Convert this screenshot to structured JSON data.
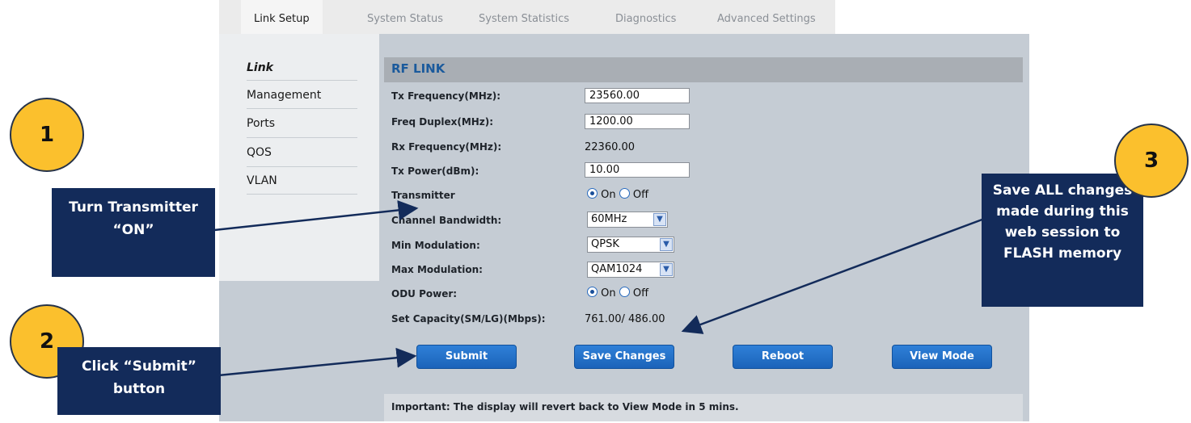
{
  "tabs": [
    {
      "label": "Link Setup",
      "active": true
    },
    {
      "label": "System Status",
      "active": false
    },
    {
      "label": "System Statistics",
      "active": false
    },
    {
      "label": "Diagnostics",
      "active": false
    },
    {
      "label": "Advanced Settings",
      "active": false
    }
  ],
  "sidebar": {
    "items": [
      {
        "label": "Link",
        "active": true
      },
      {
        "label": "Management",
        "active": false
      },
      {
        "label": "Ports",
        "active": false
      },
      {
        "label": "QOS",
        "active": false
      },
      {
        "label": "VLAN",
        "active": false
      }
    ]
  },
  "rf": {
    "title": "RF LINK",
    "tx_freq_label": "Tx Frequency(MHz):",
    "tx_freq_value": "23560.00",
    "freq_duplex_label": "Freq Duplex(MHz):",
    "freq_duplex_value": "1200.00",
    "rx_freq_label": "Rx Frequency(MHz):",
    "rx_freq_value": "22360.00",
    "tx_power_label": "Tx Power(dBm):",
    "tx_power_value": "10.00",
    "transmitter_label": "Transmitter",
    "transmitter_on": "On",
    "transmitter_off": "Off",
    "channel_bw_label": "Channel Bandwidth:",
    "channel_bw_value": "60MHz",
    "min_mod_label": "Min Modulation:",
    "min_mod_value": "QPSK",
    "max_mod_label": "Max Modulation:",
    "max_mod_value": "QAM1024",
    "odu_power_label": "ODU Power:",
    "odu_on": "On",
    "odu_off": "Off",
    "capacity_label": "Set Capacity(SM/LG)(Mbps):",
    "capacity_value": "761.00/ 486.00"
  },
  "buttons": {
    "submit": "Submit",
    "save": "Save Changes",
    "reboot": "Reboot",
    "view_mode": "View Mode"
  },
  "footer": {
    "note": "Important: The display will revert back to View Mode in 5 mins."
  },
  "annotations": {
    "step1": {
      "number": "1",
      "text": "Turn Transmitter “ON”"
    },
    "step2": {
      "number": "2",
      "text": "Click “Submit” button"
    },
    "step3": {
      "number": "3",
      "text": "Save ALL changes made during this web session to FLASH memory"
    }
  },
  "colors": {
    "panel": "#c5ccd4",
    "button": "#1b63b9",
    "callout": "#132b5a",
    "circle": "#fbc02d"
  }
}
